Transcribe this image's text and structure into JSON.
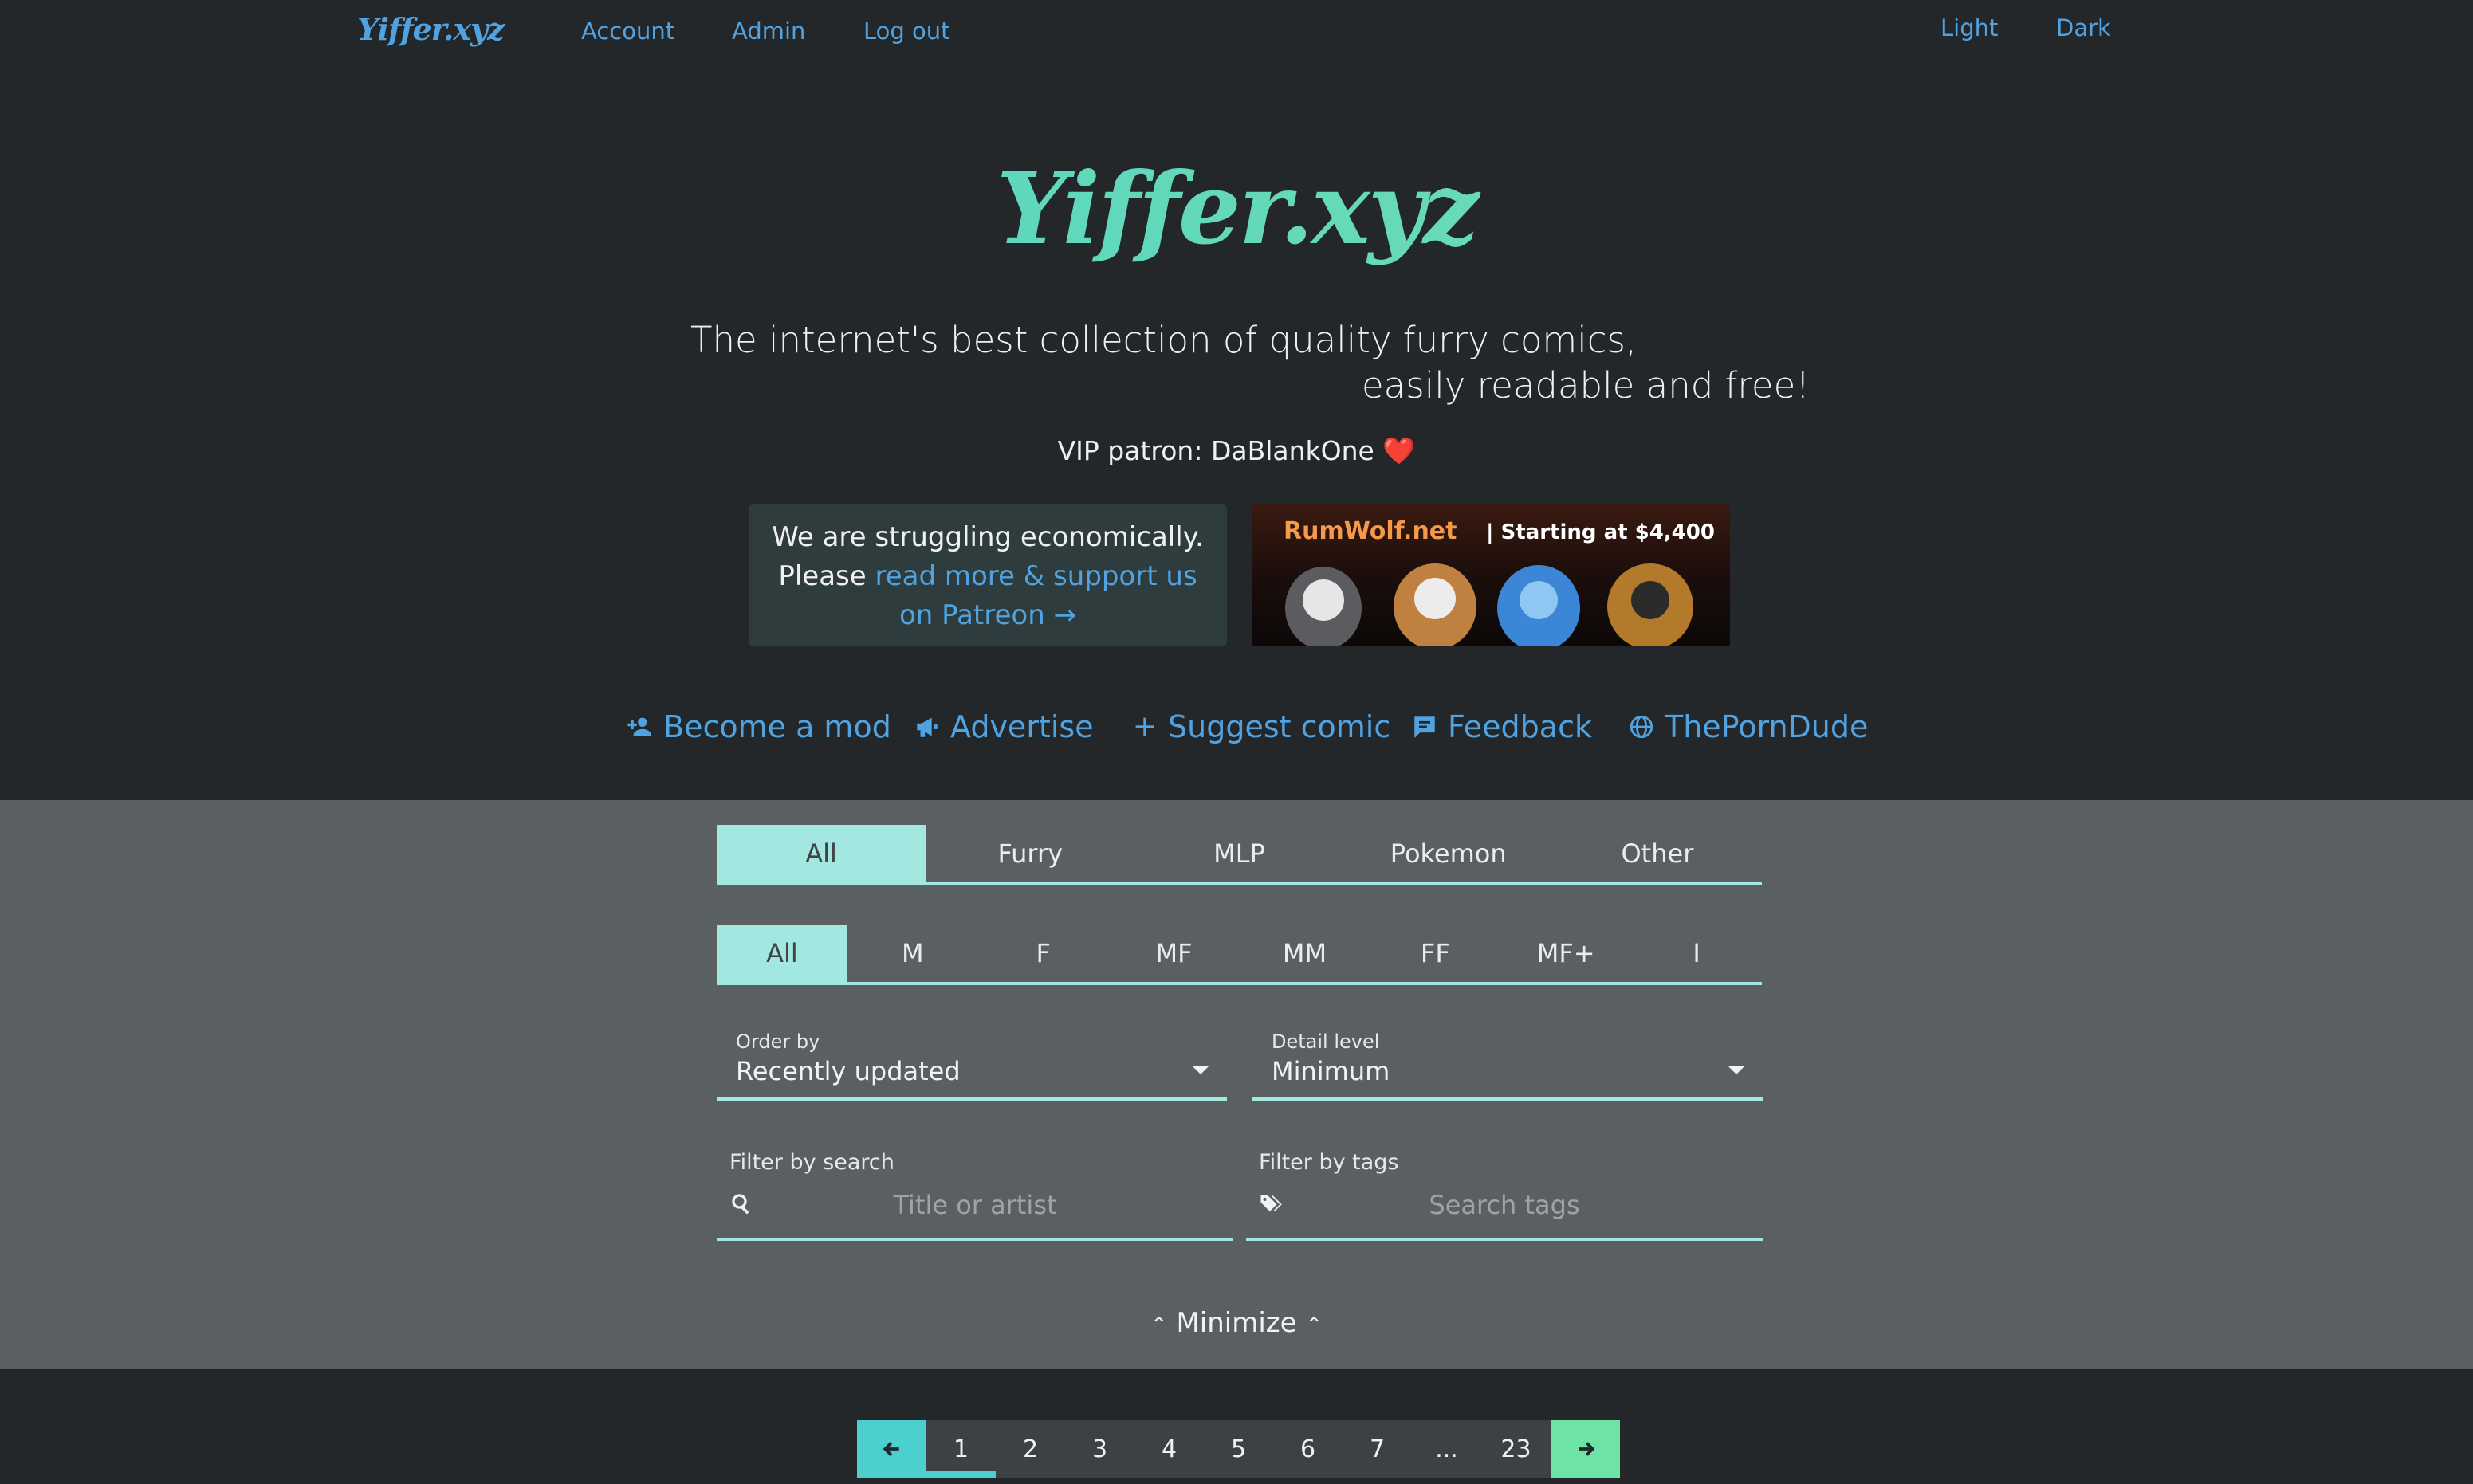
{
  "nav": {
    "logo": "Yiffer.xyz",
    "links": [
      "Account",
      "Admin",
      "Log out"
    ],
    "theme": [
      "Light",
      "Dark"
    ]
  },
  "hero": {
    "title": "Yiffer.xyz",
    "tagline_line1": "The internet's best collection of quality furry comics,",
    "tagline_line2": "easily readable and free!",
    "vip": "VIP patron: DaBlankOne ❤️"
  },
  "notice": {
    "line1": "We are struggling economically.",
    "please": "Please ",
    "link": "read more & support us on Patreon →"
  },
  "ad": {
    "brand": "RumWolf.net",
    "price": "| Starting at $4,400"
  },
  "actions": [
    {
      "label": "Become a mod",
      "icon": "add-user-icon"
    },
    {
      "label": "Advertise",
      "icon": "megaphone-icon"
    },
    {
      "label": "Suggest comic",
      "icon": "plus-icon"
    },
    {
      "label": "Feedback",
      "icon": "feedback-icon"
    },
    {
      "label": "ThePornDude",
      "icon": "globe-icon"
    }
  ],
  "category_tabs": {
    "items": [
      "All",
      "Furry",
      "MLP",
      "Pokemon",
      "Other"
    ],
    "selected": "All"
  },
  "tag_tabs": {
    "items": [
      "All",
      "M",
      "F",
      "MF",
      "MM",
      "FF",
      "MF+",
      "I"
    ],
    "selected": "All"
  },
  "order_by": {
    "label": "Order by",
    "value": "Recently updated"
  },
  "detail_level": {
    "label": "Detail level",
    "value": "Minimum"
  },
  "search": {
    "label": "Filter by search",
    "placeholder": "Title or artist",
    "icon": "search-icon"
  },
  "tags": {
    "label": "Filter by tags",
    "placeholder": "Search tags",
    "icon": "tags-icon"
  },
  "minimize": "Minimize",
  "pagination": {
    "pages": [
      "1",
      "2",
      "3",
      "4",
      "5",
      "6",
      "7",
      "...",
      "23"
    ],
    "current": "1"
  },
  "colors": {
    "accent": "#51a2e0",
    "teal": "#a2e7e0",
    "bg_dark": "#24272a",
    "bg_filter": "#5a5f62"
  }
}
